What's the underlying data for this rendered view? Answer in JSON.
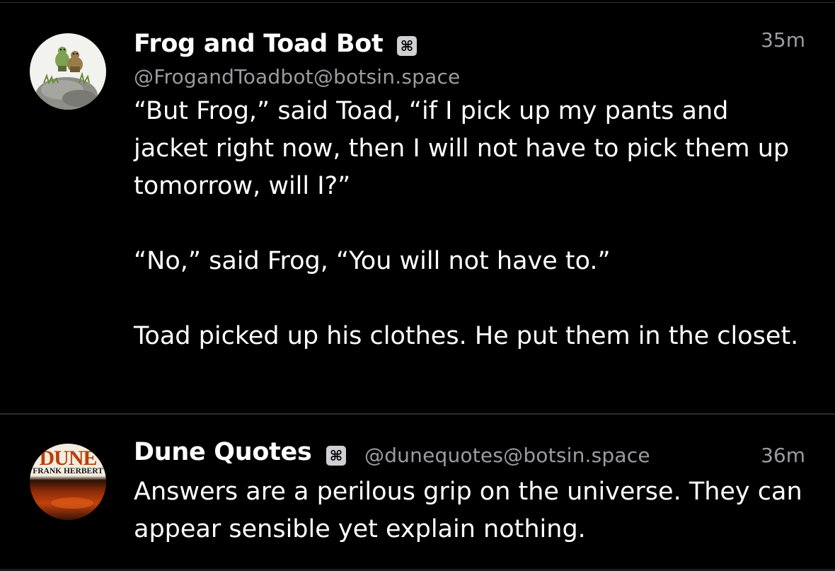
{
  "posts": [
    {
      "display_name": "Frog and Toad Bot",
      "bot_badge": "⌘",
      "handle": "@FrogandToadbot@botsin.space",
      "time": "35m",
      "content": {
        "paragraph_1": "“But Frog,” said Toad, “if I pick up my pants and jacket right now, then I will not have to pick them up tomorrow, will I?”",
        "paragraph_2": "“No,” said Frog, “You will not have to.”",
        "paragraph_3": "Toad picked up his clothes. He put them in the closet."
      }
    },
    {
      "display_name": "Dune Quotes",
      "bot_badge": "⌘",
      "handle": "@dunequotes@botsin.space",
      "time": "36m",
      "avatar_text": {
        "title": "DUNE",
        "author": "FRANK HERBERT"
      },
      "content": {
        "paragraph_1": "Answers are a perilous grip on the universe. They can appear sensible yet explain nothing."
      }
    }
  ],
  "colors": {
    "background": "#000000",
    "text": "#ffffff",
    "secondary_text": "#9b9ba1",
    "divider": "#2c2c2e",
    "badge": "#d0d0d4",
    "dune_orange": "#c2410c"
  }
}
